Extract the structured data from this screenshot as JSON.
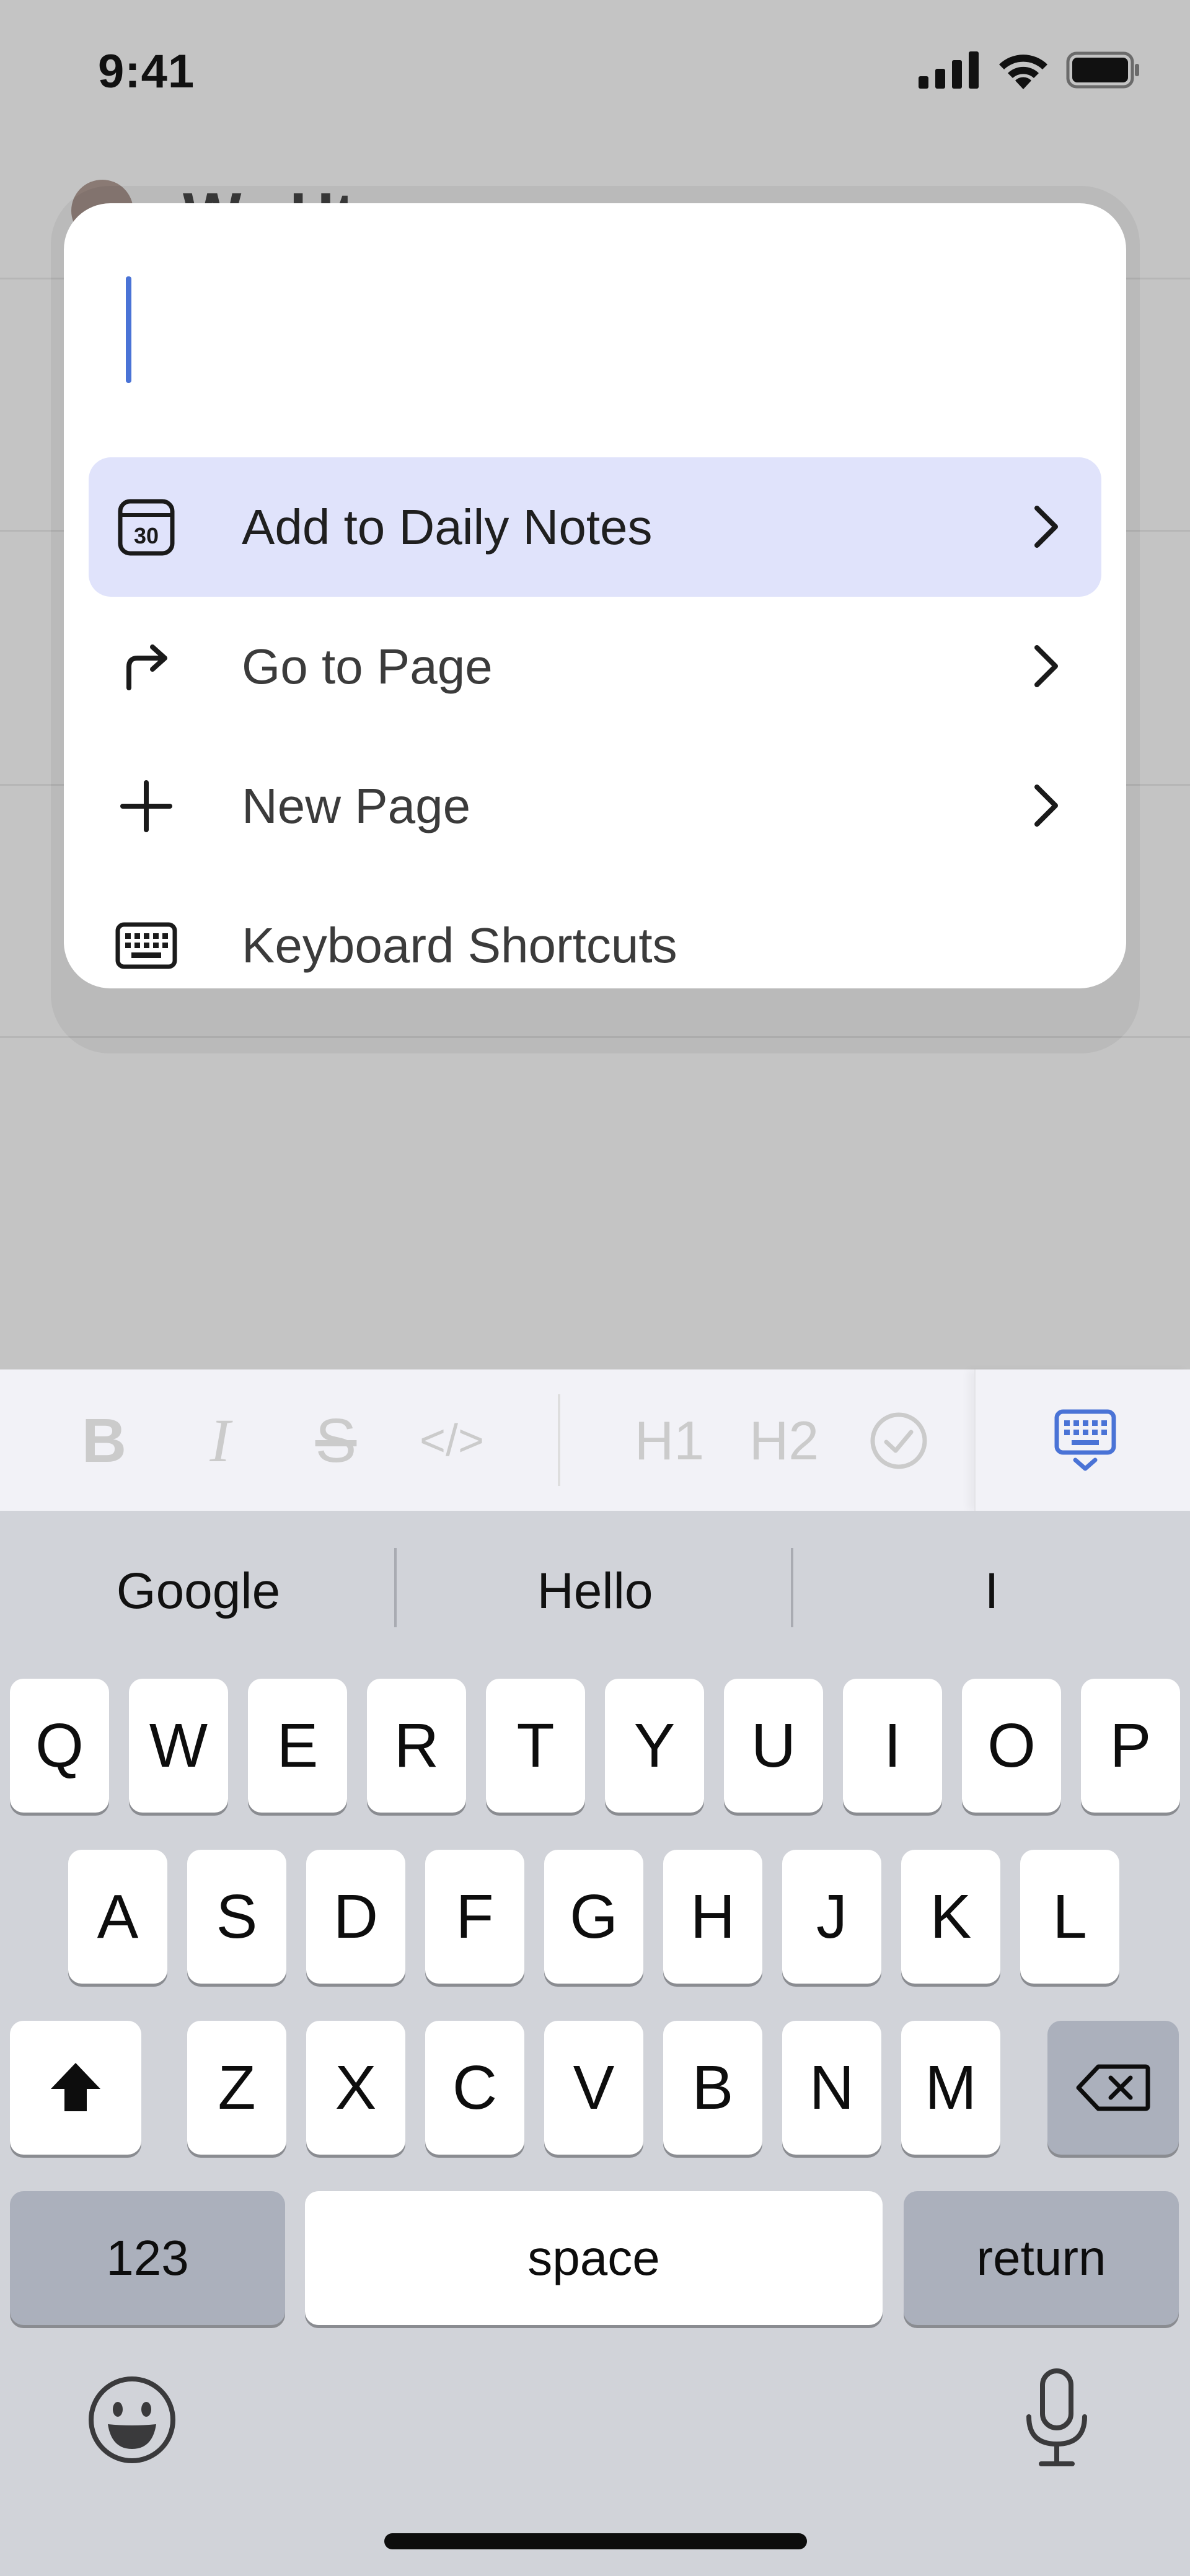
{
  "status_bar": {
    "time": "9:41",
    "icons": [
      "cellular-signal-icon",
      "wifi-icon",
      "battery-icon"
    ]
  },
  "background_app": {
    "title": "W...Ht"
  },
  "palette": {
    "input_value": "",
    "items": [
      {
        "label": "Add to Daily Notes",
        "icon": "calendar-30-icon",
        "has_chevron": true,
        "active": true
      },
      {
        "label": "Go to Page",
        "icon": "forward-arrow-icon",
        "has_chevron": true,
        "active": false
      },
      {
        "label": "New Page",
        "icon": "plus-icon",
        "has_chevron": true,
        "active": false
      },
      {
        "label": "Keyboard Shortcuts",
        "icon": "keyboard-icon",
        "has_chevron": false,
        "active": false
      }
    ],
    "calendar_icon_number": "30"
  },
  "format_bar": {
    "buttons": [
      {
        "name": "bold",
        "glyph": "B"
      },
      {
        "name": "italic",
        "glyph": "I"
      },
      {
        "name": "strikethrough",
        "glyph": "S"
      },
      {
        "name": "code",
        "glyph": "</>"
      },
      {
        "name": "heading-1",
        "glyph": "H1"
      },
      {
        "name": "heading-2",
        "glyph": "H2"
      },
      {
        "name": "checkbox",
        "glyph": "☑"
      }
    ],
    "accent_color": "#4a73d6"
  },
  "keyboard": {
    "suggestions": [
      "Google",
      "Hello",
      "I"
    ],
    "row1": [
      "Q",
      "W",
      "E",
      "R",
      "T",
      "Y",
      "U",
      "I",
      "O",
      "P"
    ],
    "row2": [
      "A",
      "S",
      "D",
      "F",
      "G",
      "H",
      "J",
      "K",
      "L"
    ],
    "row3": [
      "Z",
      "X",
      "C",
      "V",
      "B",
      "N",
      "M"
    ],
    "numbers_label": "123",
    "space_label": "space",
    "return_label": "return"
  }
}
